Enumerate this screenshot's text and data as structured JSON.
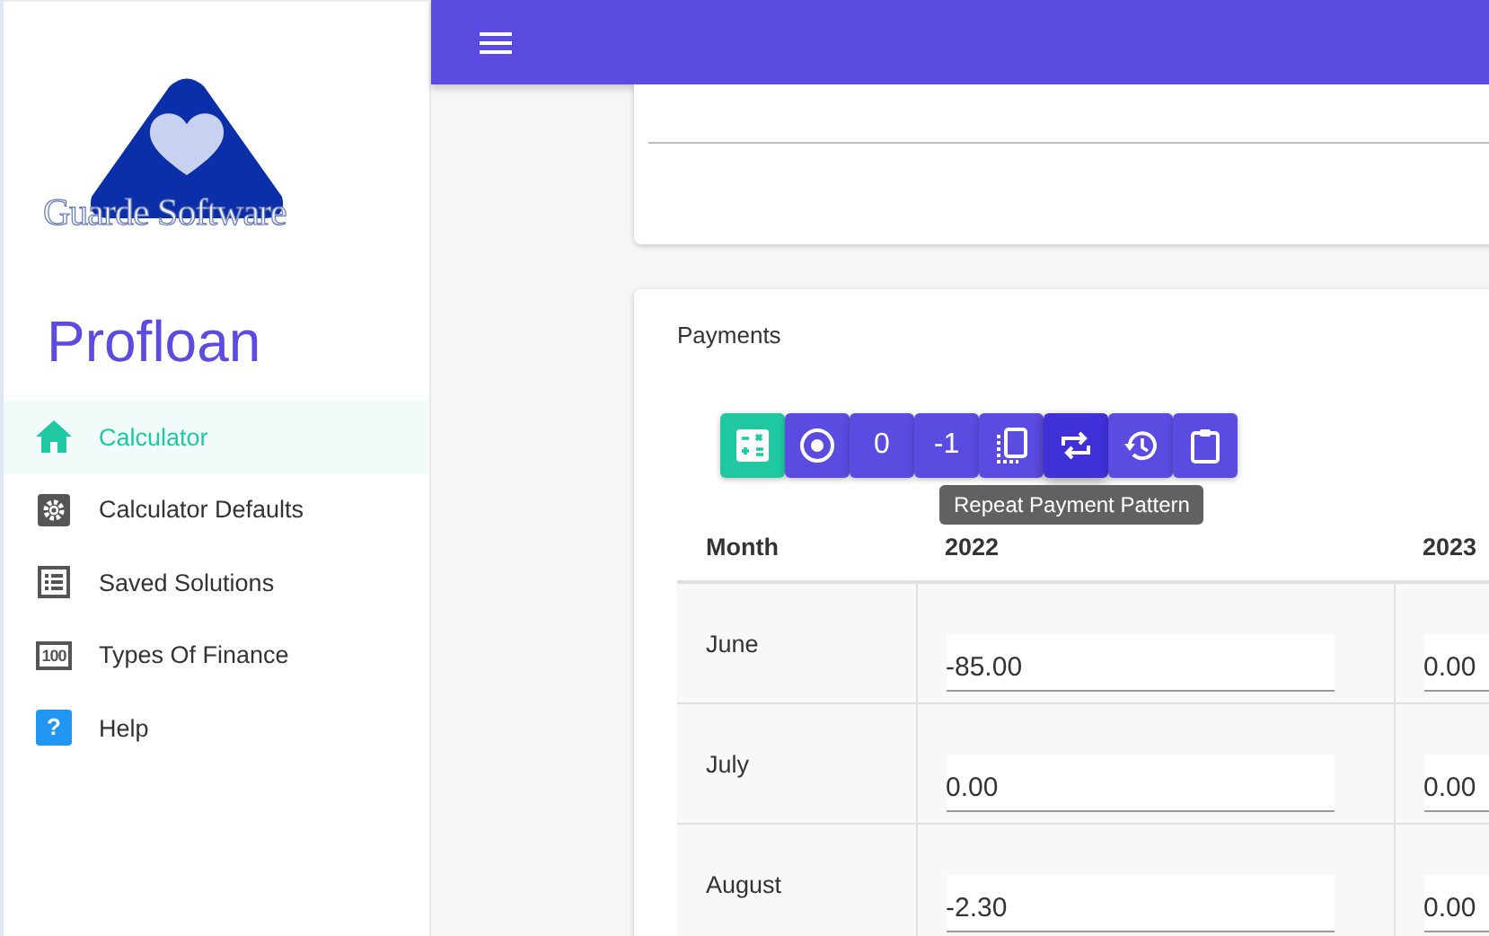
{
  "logo": {
    "text": "Guarde Software"
  },
  "app_title": "Profloan",
  "sidebar": {
    "items": [
      {
        "label": "Calculator",
        "kind": "home",
        "selected": true
      },
      {
        "label": "Calculator Defaults",
        "kind": "gear",
        "selected": false
      },
      {
        "label": "Saved Solutions",
        "kind": "list",
        "selected": false
      },
      {
        "label": "Types Of Finance",
        "kind": "counter",
        "glyph": "100",
        "selected": false
      },
      {
        "label": "Help",
        "kind": "help",
        "glyph": "?",
        "selected": false
      }
    ]
  },
  "payments": {
    "title": "Payments",
    "toolbar": [
      {
        "kind": "calculator",
        "color": "#1fc8a0",
        "selected": false
      },
      {
        "kind": "radio",
        "color": "#5b4be0",
        "selected": false
      },
      {
        "kind": "text",
        "label": "0",
        "color": "#5b4be0",
        "selected": false
      },
      {
        "kind": "text",
        "label": "-1",
        "color": "#5b4be0",
        "selected": false
      },
      {
        "kind": "copy",
        "color": "#5b4be0",
        "selected": false
      },
      {
        "kind": "repeat",
        "color": "#4030d8",
        "selected": true
      },
      {
        "kind": "history",
        "color": "#5b4be0",
        "selected": false
      },
      {
        "kind": "clipboard",
        "color": "#5b4be0",
        "selected": false
      }
    ],
    "tooltip": "Repeat Payment Pattern",
    "table": {
      "columns": [
        "Month",
        "2022",
        "2023"
      ],
      "rows": [
        {
          "month": "June",
          "values": [
            "-85.00",
            "0.00"
          ]
        },
        {
          "month": "July",
          "values": [
            "0.00",
            "0.00"
          ]
        },
        {
          "month": "August",
          "values": [
            "-2.30",
            "0.00"
          ]
        }
      ]
    }
  }
}
